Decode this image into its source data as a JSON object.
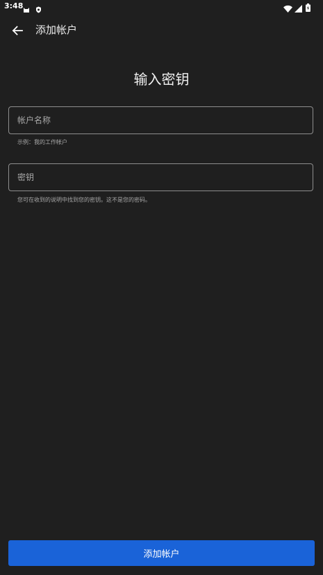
{
  "status_bar": {
    "time": "3:48",
    "left_icons": [
      "cat-icon",
      "shield-icon"
    ],
    "right_icons": [
      "wifi-icon",
      "signal-icon",
      "battery-icon"
    ]
  },
  "app_bar": {
    "back_icon": "arrow-left-icon",
    "title": "添加帐户"
  },
  "page": {
    "heading": "输入密钥"
  },
  "form": {
    "account_name": {
      "placeholder": "帐户名称",
      "value": "",
      "helper": "示例：我的工作帐户"
    },
    "secret_key": {
      "placeholder": "密钥",
      "value": "",
      "helper": "您可在收到的说明中找到您的密钥。这不是您的密码。"
    }
  },
  "actions": {
    "add_label": "添加帐户"
  },
  "colors": {
    "background": "#1f1f1f",
    "accent": "#1a63d8",
    "border": "#8e8e8e"
  }
}
